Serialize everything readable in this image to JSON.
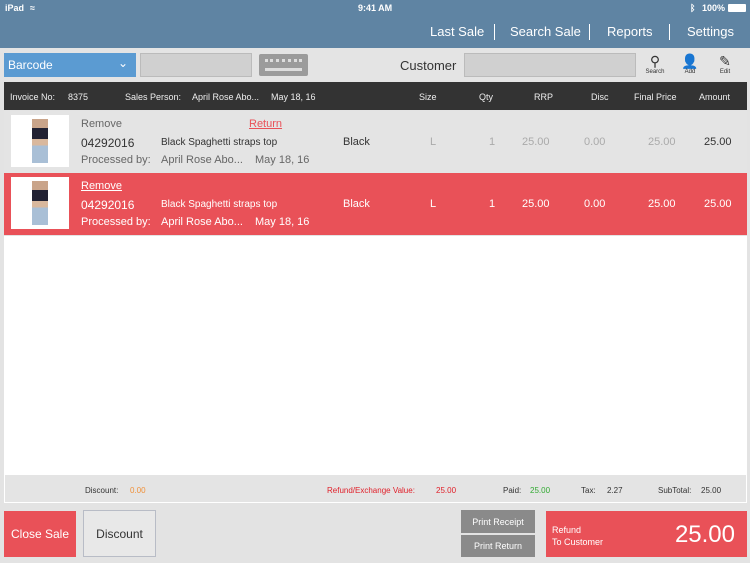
{
  "status": {
    "device": "iPad",
    "time": "9:41 AM",
    "battery": "100%"
  },
  "nav": [
    "Last Sale",
    "Search Sale",
    "Reports",
    "Settings"
  ],
  "toolbar": {
    "barcode": "Barcode",
    "customer_label": "Customer",
    "search": "Search",
    "add": "Add",
    "edit": "Edit"
  },
  "header": {
    "invoice_label": "Invoice No:",
    "invoice_no": "8375",
    "sales_label": "Sales Person:",
    "sales_person": "April Rose  Abo...",
    "date": "May 18, 16",
    "cols": [
      "Size",
      "Qty",
      "RRP",
      "Disc",
      "Final Price",
      "Amount"
    ]
  },
  "rows": [
    {
      "remove": "Remove",
      "return": "Return",
      "code": "04292016",
      "desc": "Black Spaghetti straps top",
      "processed": "Processed by:",
      "person": "April Rose Abo...",
      "date": "May 18, 16",
      "color": "Black",
      "size": "L",
      "qty": "1",
      "rrp": "25.00",
      "disc": "0.00",
      "final": "25.00",
      "amount": "25.00"
    },
    {
      "remove": "Remove",
      "code": "04292016",
      "desc": "Black Spaghetti straps top",
      "processed": "Processed by:",
      "person": "April Rose Abo...",
      "date": "May 18, 16",
      "color": "Black",
      "size": "L",
      "qty": "1",
      "rrp": "25.00",
      "disc": "0.00",
      "final": "25.00",
      "amount": "25.00"
    }
  ],
  "totals": {
    "discount_label": "Discount:",
    "discount": "0.00",
    "refund_label": "Refund/Exchange Value:",
    "refund": "25.00",
    "paid_label": "Paid:",
    "paid": "25.00",
    "tax_label": "Tax:",
    "tax": "2.27",
    "subtotal_label": "SubTotal:",
    "subtotal": "25.00"
  },
  "buttons": {
    "close_sale": "Close Sale",
    "discount": "Discount",
    "print_receipt": "Print Receipt",
    "print_return": "Print Return",
    "refund_line1": "Refund",
    "refund_line2": "To Customer",
    "refund_amount": "25.00"
  },
  "colors": {
    "header": "#5f84a3",
    "accent": "#e95158",
    "barcode": "#5b9bd2"
  }
}
